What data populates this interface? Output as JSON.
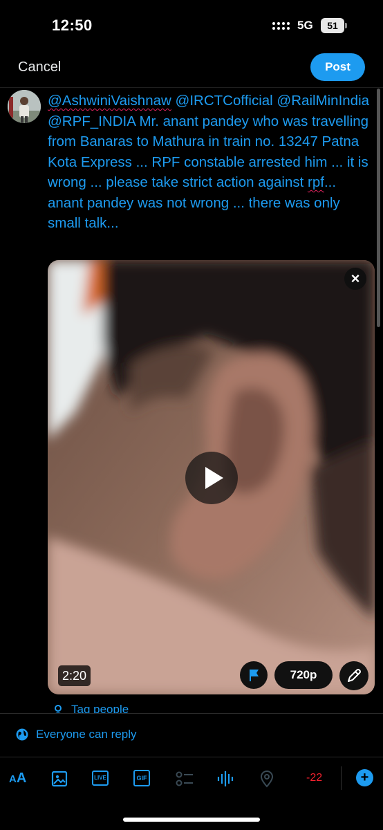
{
  "status_bar": {
    "time": "12:50",
    "network": "5G",
    "battery": "51"
  },
  "header": {
    "cancel_label": "Cancel",
    "post_label": "Post"
  },
  "compose": {
    "mention_1": "@AshwiniVaishnaw",
    "mention_2": "@IRCTCofficial",
    "mention_3": "@RailMinIndia",
    "mention_4": "@RPF_INDIA",
    "body_1": " Mr. anant pandey who was travelling from Banaras to Mathura in train no. 13247 Patna Kota Express ... RPF constable arrested him ... it is wrong ... please take strict action against ",
    "body_word": "rpf",
    "body_2": "... anant pandey was not wrong ... there was only small talk..."
  },
  "video": {
    "duration": "2:20",
    "quality": "720p",
    "close_glyph": "×"
  },
  "tag_people_label": "Tag people",
  "reply_setting": "Everyone can reply",
  "toolbar": {
    "aa_small": "A",
    "aa_big": "A",
    "live_label": "LIVE",
    "gif_label": "GIF",
    "char_count": "-22",
    "add_glyph": "+"
  },
  "colors": {
    "accent": "#1d9bf0",
    "background": "#000000",
    "error": "#f4212e"
  },
  "icons": [
    "signal-icon",
    "battery-icon",
    "close-icon",
    "play-icon",
    "flag-icon",
    "edit-icon",
    "tag-person-icon",
    "globe-icon",
    "text-format-icon",
    "image-icon",
    "live-icon",
    "gif-icon",
    "poll-icon",
    "audio-space-icon",
    "location-icon",
    "add-icon"
  ]
}
